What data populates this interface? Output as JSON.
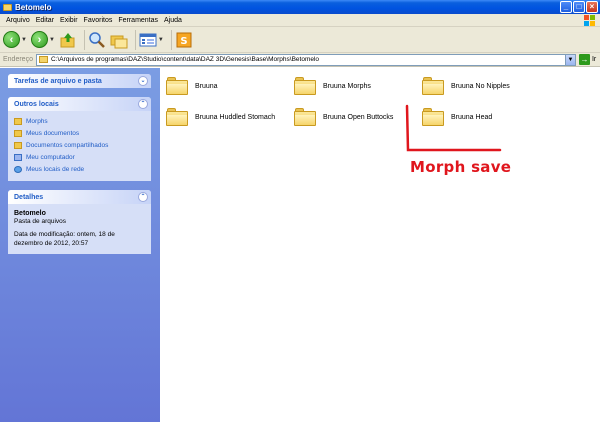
{
  "window": {
    "title": "Betomelo"
  },
  "menu": [
    "Arquivo",
    "Editar",
    "Exibir",
    "Favoritos",
    "Ferramentas",
    "Ajuda"
  ],
  "address": {
    "label": "Endereço",
    "path": "C:\\Arquivos de programas\\DAZ\\Studio\\content\\data\\DAZ 3D\\Genesis\\Base\\Morphs\\Betomelo",
    "go_label": "Ir"
  },
  "panels": {
    "tasks": {
      "title": "Tarefas de arquivo e pasta"
    },
    "other": {
      "title": "Outros locais",
      "links": [
        "Morphs",
        "Meus documentos",
        "Documentos compartilhados",
        "Meu computador",
        "Meus locais de rede"
      ]
    },
    "details": {
      "title": "Detalhes",
      "name": "Betomelo",
      "type": "Pasta de arquivos",
      "modified_line1": "Data de modificação: ontem, 18 de",
      "modified_line2": "dezembro de 2012, 20:57"
    }
  },
  "folders": [
    {
      "name": "Bruuna"
    },
    {
      "name": "Bruuna Morphs"
    },
    {
      "name": "Bruuna No Nipples"
    },
    {
      "name": "Bruuna Huddled Stomach"
    },
    {
      "name": "Bruuna Open Buttocks"
    },
    {
      "name": "Bruuna Head"
    }
  ],
  "annotation": {
    "text": "Morph save",
    "color": "#e0161d"
  },
  "colors": {
    "titlebar": "#0053e0",
    "sidebar": "#6375d6",
    "link": "#215dc6"
  }
}
